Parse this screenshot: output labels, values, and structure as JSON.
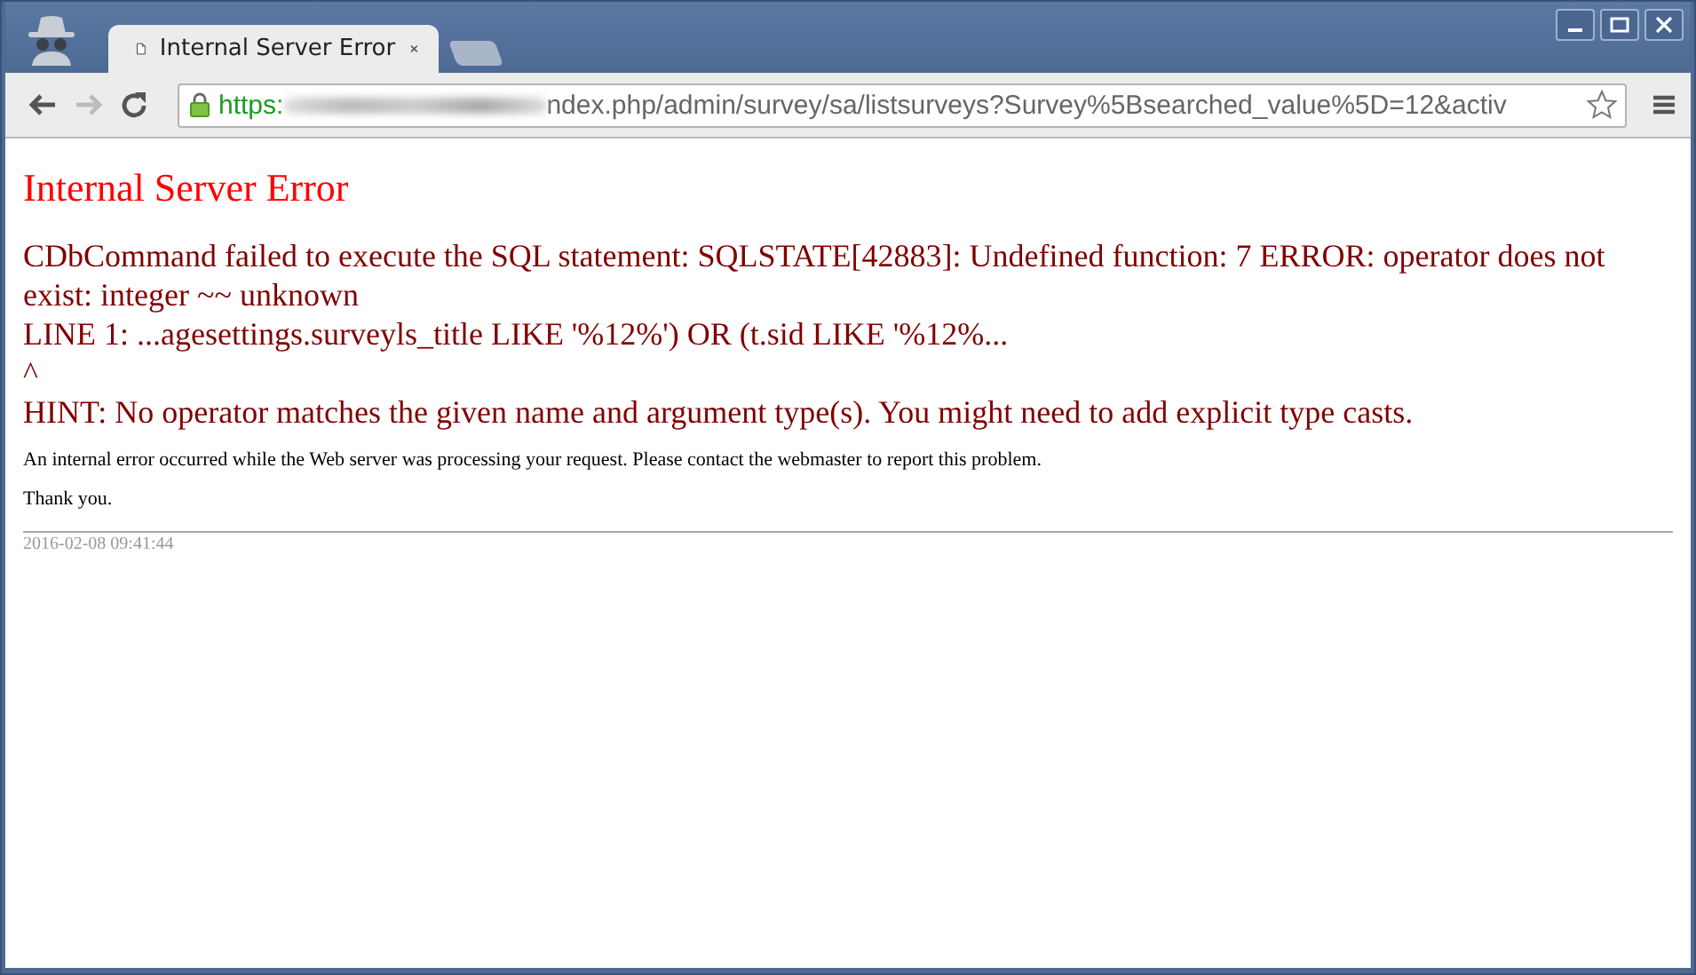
{
  "window": {
    "controls": [
      {
        "kind": "minimize"
      },
      {
        "kind": "maximize"
      },
      {
        "kind": "close"
      }
    ]
  },
  "tabs": [
    {
      "title": "Internal Server Error",
      "selected": true
    }
  ],
  "address_bar": {
    "scheme": "https:",
    "path": "ndex.php/admin/survey/sa/listsurveys?Survey%5Bsearched_value%5D=12&activ",
    "secure": true
  },
  "page": {
    "heading": "Internal Server Error",
    "message_lines": [
      "CDbCommand failed to execute the SQL statement: SQLSTATE[42883]: Undefined function: 7 ERROR: operator does not exist: integer ~~ unknown",
      "LINE 1: ...agesettings.surveyls_title LIKE '%12%') OR (t.sid LIKE '%12%...",
      "^",
      "HINT: No operator matches the given name and argument type(s). You might need to add explicit type casts."
    ],
    "notice": "An internal error occurred while the Web server was processing your request. Please contact the webmaster to report this problem.",
    "thanks": "Thank you.",
    "timestamp": "2016-02-08 09:41:44"
  }
}
